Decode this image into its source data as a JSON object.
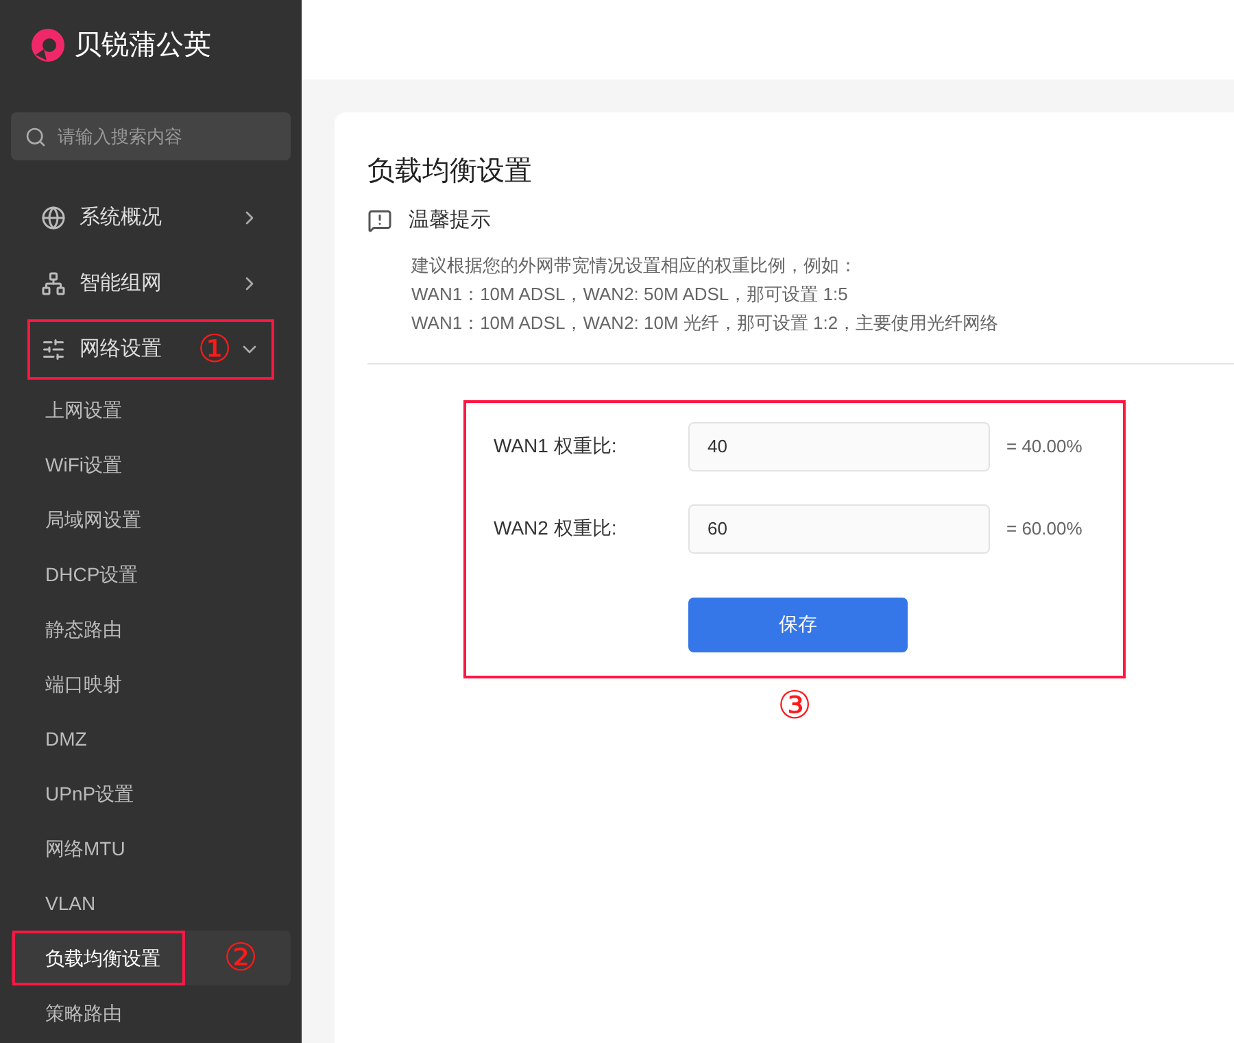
{
  "brand": {
    "name": "贝锐蒲公英"
  },
  "search": {
    "placeholder": "请输入搜索内容"
  },
  "sidebar": {
    "items": [
      {
        "label": "系统概况",
        "expanded": false,
        "highlighted": false
      },
      {
        "label": "智能组网",
        "expanded": false,
        "highlighted": false
      },
      {
        "label": "网络设置",
        "expanded": true,
        "highlighted": true,
        "annotation": "①",
        "children": [
          {
            "label": "上网设置",
            "selected": false,
            "highlighted": false
          },
          {
            "label": "WiFi设置",
            "selected": false,
            "highlighted": false
          },
          {
            "label": "局域网设置",
            "selected": false,
            "highlighted": false
          },
          {
            "label": "DHCP设置",
            "selected": false,
            "highlighted": false
          },
          {
            "label": "静态路由",
            "selected": false,
            "highlighted": false
          },
          {
            "label": "端口映射",
            "selected": false,
            "highlighted": false
          },
          {
            "label": "DMZ",
            "selected": false,
            "highlighted": false
          },
          {
            "label": "UPnP设置",
            "selected": false,
            "highlighted": false
          },
          {
            "label": "网络MTU",
            "selected": false,
            "highlighted": false
          },
          {
            "label": "VLAN",
            "selected": false,
            "highlighted": false
          },
          {
            "label": "负载均衡设置",
            "selected": true,
            "highlighted": true,
            "annotation": "②"
          },
          {
            "label": "策略路由",
            "selected": false,
            "highlighted": false
          }
        ]
      }
    ]
  },
  "page": {
    "title": "负载均衡设置",
    "tip": {
      "title": "温馨提示",
      "lines": [
        "建议根据您的外网带宽情况设置相应的权重比例，例如：",
        "WAN1：10M ADSL，WAN2: 50M ADSL，那可设置 1:5",
        "WAN1：10M ADSL，WAN2: 10M 光纤，那可设置 1:2，主要使用光纤网络"
      ]
    },
    "form": {
      "highlighted": true,
      "annotation": "③",
      "fields": [
        {
          "label": "WAN1 权重比:",
          "value": "40",
          "result": "= 40.00%"
        },
        {
          "label": "WAN2 权重比:",
          "value": "60",
          "result": "= 60.00%"
        }
      ],
      "button": "保存"
    }
  }
}
